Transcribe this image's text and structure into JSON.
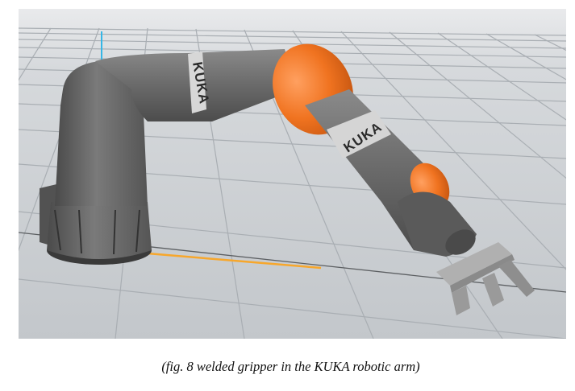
{
  "figure": {
    "scene": "3d-simulation-viewport",
    "brand_marks": [
      "KUKA",
      "KUKA"
    ],
    "colors": {
      "floor": "#c9cdd1",
      "grid": "#a9aeb3",
      "arm_gray": "#6d6d6d",
      "arm_orange": "#f07320",
      "gripper": "#9a9a9a",
      "axis_x": "#f7a72c",
      "axis_z": "#35b6e6"
    }
  },
  "caption": "(fig. 8 welded gripper in the KUKA robotic arm)"
}
